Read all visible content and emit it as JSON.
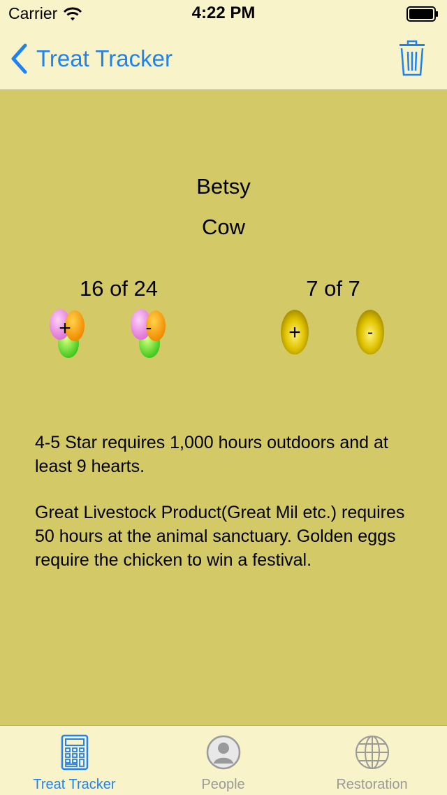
{
  "status_bar": {
    "carrier": "Carrier",
    "time": "4:22 PM"
  },
  "nav": {
    "back_label": "Treat Tracker",
    "accent_color": "#1e82f4"
  },
  "animal": {
    "name": "Betsy",
    "type": "Cow"
  },
  "counters": {
    "hearts": "16 of 24",
    "stars": "7 of 7"
  },
  "controls": {
    "plus_symbol": "+",
    "minus_symbol": "-"
  },
  "info": {
    "paragraph_1": "4-5 Star requires 1,000 hours outdoors and at least 9 hearts.",
    "paragraph_2": "Great Livestock Product(Great Mil etc.) requires 50 hours at the animal sanctuary. Golden eggs require the chicken to win a festival."
  },
  "tabs": [
    {
      "label": "Treat Tracker",
      "icon": "calculator-icon",
      "active": true
    },
    {
      "label": "People",
      "icon": "person-icon",
      "active": false
    },
    {
      "label": "Restoration",
      "icon": "globe-icon",
      "active": false
    }
  ],
  "colors": {
    "background": "#d3c967",
    "bars": "#f8f3c8",
    "accent": "#1e82f4",
    "inactive_tab": "#9a9a9a"
  }
}
